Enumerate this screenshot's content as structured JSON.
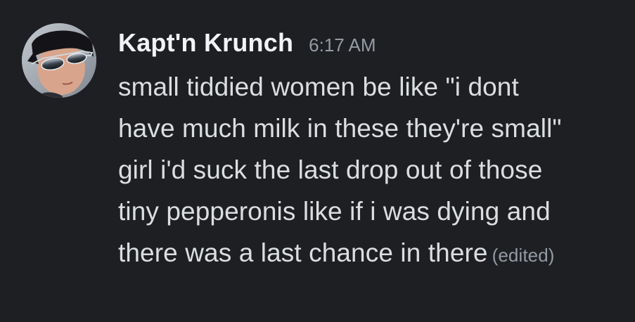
{
  "message": {
    "author": "Kapt'n Krunch",
    "timestamp": "6:17 AM",
    "body": "small tiddied women be like \"i dont\nhave much milk in these they're small\"\ngirl i'd suck the last drop out of those\ntiny pepperonis like if i was dying and\nthere was a last chance in there",
    "edited_label": "(edited)",
    "avatar_icon": "user-avatar-sunglasses"
  },
  "colors": {
    "background": "#1e1f23",
    "username": "#f2f3f5",
    "timestamp": "#949ba4",
    "body_text": "#dbdee1"
  }
}
